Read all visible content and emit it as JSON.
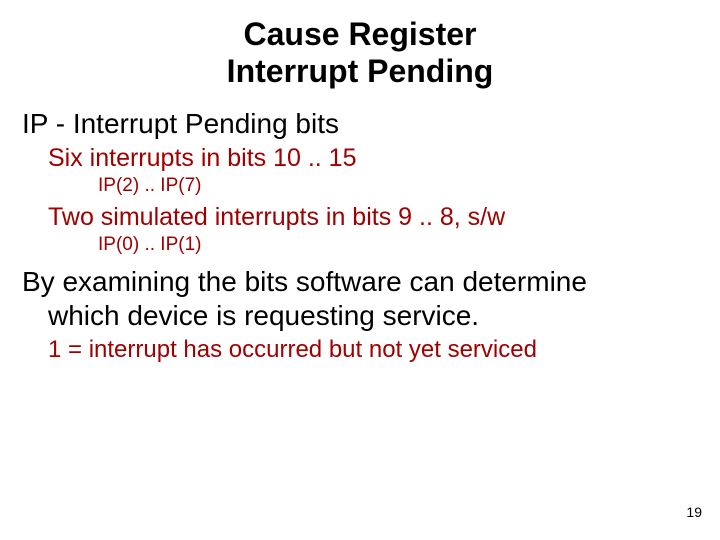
{
  "title_line1": "Cause Register",
  "title_line2": "Interrupt Pending",
  "lines": {
    "ip_heading": "IP - Interrupt Pending bits",
    "six_interrupts": "Six interrupts in bits 10 .. 15",
    "ip2_ip7": "IP(2) .. IP(7)",
    "two_sim": "Two simulated interrupts in bits 9 .. 8, s/w",
    "ip0_ip1": "IP(0) .. IP(1)",
    "by_examining_1": "By examining the bits software can determine",
    "by_examining_2": "which device is requesting service.",
    "note": "1 = interrupt has occurred but not yet serviced"
  },
  "page_number": "19"
}
